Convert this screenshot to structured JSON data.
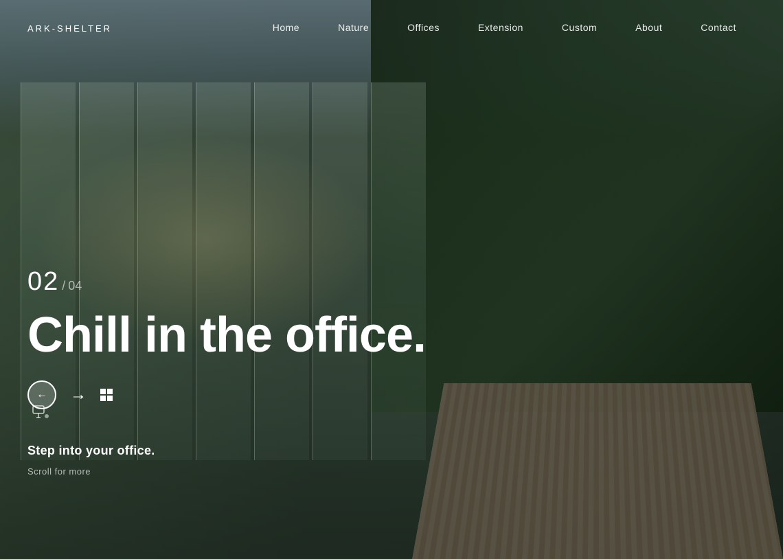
{
  "brand": {
    "name": "ARK-SHELTER"
  },
  "nav": {
    "links": [
      {
        "id": "home",
        "label": "Home"
      },
      {
        "id": "nature",
        "label": "Nature"
      },
      {
        "id": "offices",
        "label": "Offices"
      },
      {
        "id": "extension",
        "label": "Extension"
      },
      {
        "id": "custom",
        "label": "Custom"
      },
      {
        "id": "about",
        "label": "About"
      },
      {
        "id": "contact",
        "label": "Contact"
      }
    ]
  },
  "hero": {
    "slide_current": "02",
    "slide_separator": "/",
    "slide_total": "04",
    "title": "Chill in the office.",
    "subtitle": "Step into your office.",
    "scroll_label": "Scroll for more"
  },
  "controls": {
    "prev_label": "←",
    "next_label": "→"
  }
}
